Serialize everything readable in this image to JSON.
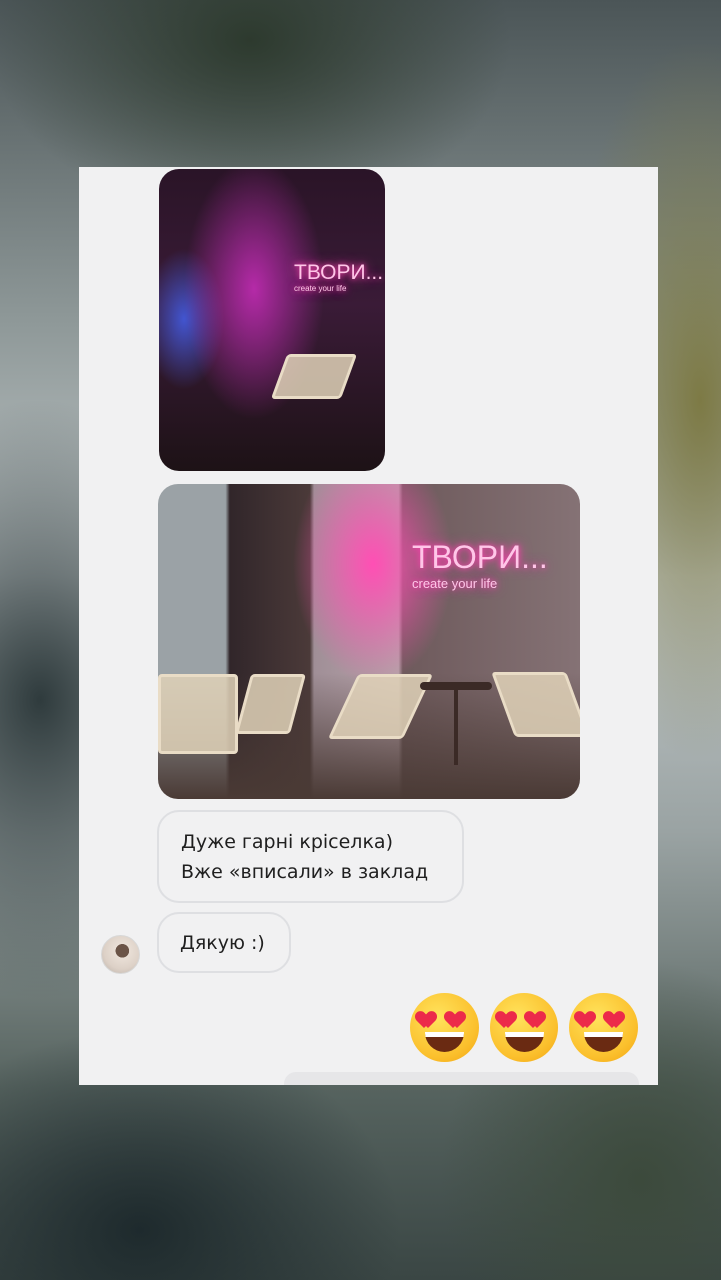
{
  "messages": [
    {
      "lines": [
        "Дуже гарні кріселка)",
        "Вже «вписали» в заклад"
      ]
    },
    {
      "lines": [
        "Дякую :)"
      ]
    }
  ],
  "photos": [
    {
      "neon_title": "ТВОРИ...",
      "neon_subtitle": "create your life"
    },
    {
      "neon_title": "ТВОРИ...",
      "neon_subtitle": "create your life"
    }
  ],
  "reactions": [
    "heart-eyes-emoji",
    "heart-eyes-emoji",
    "heart-eyes-emoji"
  ],
  "colors": {
    "card_bg": "#f1f1f2",
    "bubble_border": "#dedfe2",
    "neon": "#ff3fb0"
  }
}
